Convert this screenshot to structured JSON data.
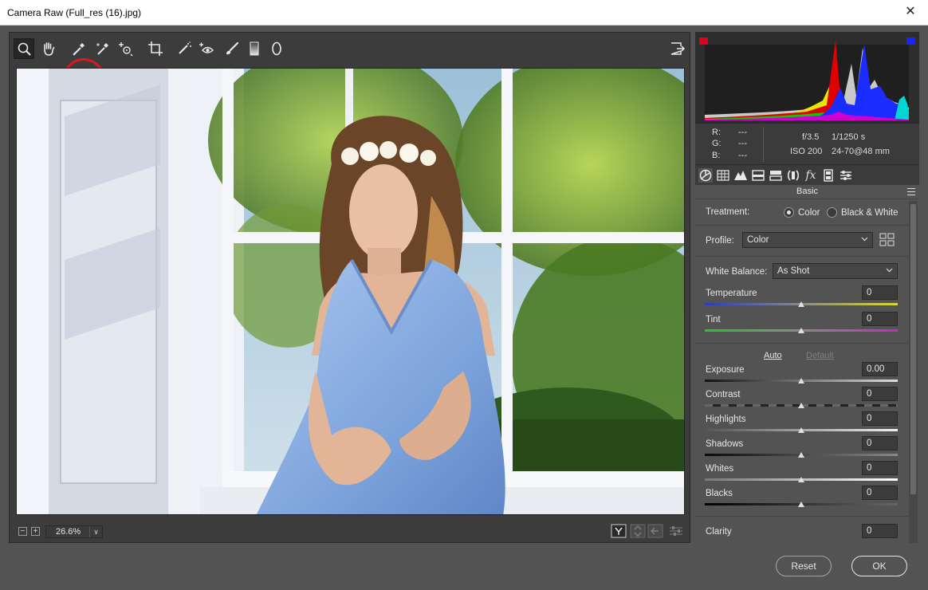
{
  "window": {
    "title": "Camera Raw (Full_res (16).jpg)",
    "close_glyph": "✕"
  },
  "toolbar": {
    "tools": [
      {
        "name": "zoom-tool-icon",
        "active": true
      },
      {
        "name": "hand-tool-icon"
      },
      {
        "name": "white-balance-tool-icon",
        "highlighted": true
      },
      {
        "name": "color-sampler-tool-icon"
      },
      {
        "name": "targeted-adjustment-tool-icon"
      },
      {
        "name": "crop-tool-icon"
      },
      {
        "name": "spot-removal-tool-icon"
      },
      {
        "name": "red-eye-tool-icon"
      },
      {
        "name": "adjustment-brush-icon"
      },
      {
        "name": "graduated-filter-icon"
      },
      {
        "name": "radial-filter-icon"
      },
      {
        "name": "fullscreen-toggle-icon"
      }
    ]
  },
  "bottombar": {
    "zoom_out": "−",
    "zoom_in": "+",
    "zoom_value": "26.6%",
    "chevron": "∨"
  },
  "info": {
    "r_label": "R:",
    "g_label": "G:",
    "b_label": "B:",
    "r_value": "---",
    "g_value": "---",
    "b_value": "---",
    "aperture": "f/3.5",
    "shutter": "1/1250 s",
    "iso": "ISO 200",
    "lens": "24-70@48 mm"
  },
  "panel": {
    "title": "Basic",
    "treatment_label": "Treatment:",
    "treatment_color": "Color",
    "treatment_bw": "Black & White",
    "profile_label": "Profile:",
    "profile_value": "Color",
    "wb_label": "White Balance:",
    "wb_value": "As Shot",
    "auto": "Auto",
    "default": "Default",
    "sliders": [
      {
        "label": "Temperature",
        "value": "0",
        "position": 0.5
      },
      {
        "label": "Tint",
        "value": "0",
        "position": 0.5
      },
      {
        "label": "Exposure",
        "value": "0.00",
        "position": 0.5
      },
      {
        "label": "Contrast",
        "value": "0",
        "position": 0.5
      },
      {
        "label": "Highlights",
        "value": "0",
        "position": 0.5
      },
      {
        "label": "Shadows",
        "value": "0",
        "position": 0.5
      },
      {
        "label": "Whites",
        "value": "0",
        "position": 0.5
      },
      {
        "label": "Blacks",
        "value": "0",
        "position": 0.5
      },
      {
        "label": "Clarity",
        "value": "0",
        "position": 0.5
      }
    ]
  },
  "buttons": {
    "reset": "Reset",
    "ok": "OK"
  },
  "colors": {
    "highlight_circle": "#e0161b",
    "panel_bg": "#535353",
    "dark_bg": "#3c3c3c"
  }
}
